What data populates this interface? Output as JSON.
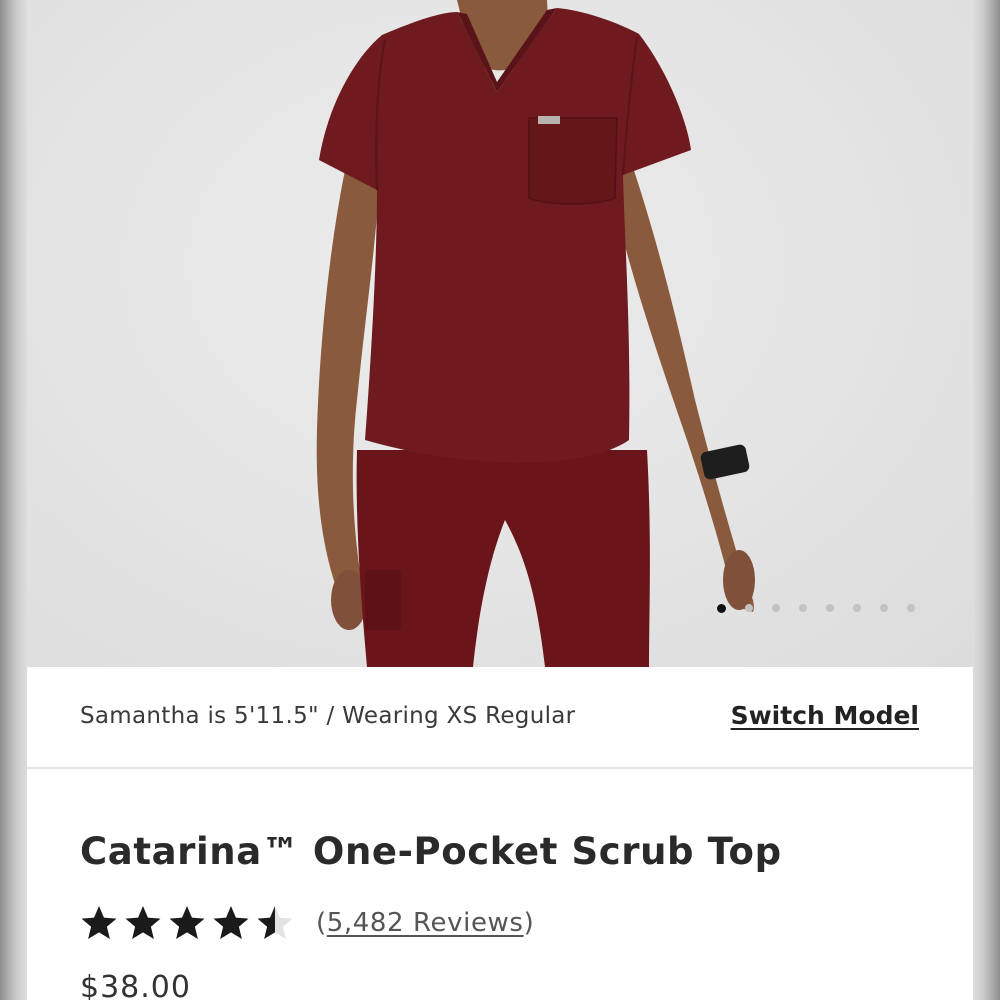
{
  "product": {
    "title": "Catarina™ One-Pocket Scrub Top",
    "price": "$38.00",
    "rating": 4.5,
    "rating_max": 5,
    "reviews_open": "(",
    "reviews_count_text": "5,482 Reviews",
    "reviews_close": ")",
    "color_swatch": "#6e1a1f"
  },
  "model": {
    "info": "Samantha is 5'11.5\" / Wearing XS Regular",
    "switch_label": "Switch Model"
  },
  "gallery": {
    "total_images": 8,
    "active_index": 0
  },
  "icons": {
    "star": "star-icon"
  }
}
